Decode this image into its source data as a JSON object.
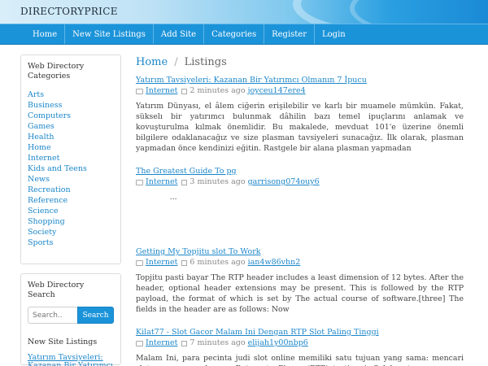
{
  "site": {
    "brand": "DIRECTORYPRICE"
  },
  "nav": [
    "Home",
    "New Site Listings",
    "Add Site",
    "Categories",
    "Register",
    "Login"
  ],
  "sidebar": {
    "directory_title": "Web Directory Categories",
    "categories": [
      "Arts",
      "Business",
      "Computers",
      "Games",
      "Health",
      "Home",
      "Internet",
      "Kids and Teens",
      "News",
      "Recreation",
      "Reference",
      "Science",
      "Shopping",
      "Society",
      "Sports"
    ],
    "search_title": "Web Directory Search",
    "search_placeholder": "Search..",
    "search_button": "Search",
    "new_listings_title": "New Site Listings",
    "new_listings": [
      "Yatırım Tavsiyeleri: Kazanan Bir Yatırımcı Olma"
    ]
  },
  "breadcrumb": {
    "home": "Home",
    "separator": "/",
    "current": "Listings"
  },
  "posts": [
    {
      "title": "Yatırım Tavsiyeleri: Kazanan Bir Yatırımcı Olmanın 7 İpucu",
      "category": "Internet",
      "time": "2 minutes ago",
      "author": "joyceu147ere4",
      "excerpt": "Yatırım Dünyası, el âlem ciğerin erişilebilir ve karlı bir muamele mümkün. Fakat, sükselı bir yatırımcı bulunmak dâhilin bazı temel ipuçlarını anlamak ve kovuşturulma kılmak önemlidir. Bu makalede, mevduat 101'e üzerine önemli bilgilere odaklanacağız ve size plasman tavsiyeleri sunacağız. İlk olarak, plasman yapmadan önce kendinizi eğitin. Rastgele bir alana plasman yapmadan"
    },
    {
      "title": "The Greatest Guide To ￼￼￼￼pg￼￼￼",
      "category": "Internet",
      "time": "3 minutes ago",
      "author": "garrisong074ouy6",
      "excerpt": "￼￼￼￼￼￼￼￼￼￼￼￼￼￼￼￼￼￼￼￼￼￼￼￼￼ ￼￼￼￼￼￼￼￼￼￼￼￼￼￼￼￼￼￼￼￼￼￼￼ ￼￼￼￼￼￼￼￼￼￼￼￼￼￼￼￼￼￼￼￼￼￼￼￼￼￼￼￼￼ ￼￼￼￼￼￼￼￼￼ ￼￼￼￼￼￼￼￼￼￼￼￼￼￼￼￼￼￼￼￼￼￼￼￼￼￼￼￼￼￼￼￼￼￼￼￼￼￼￼￼￼￼￼￼￼￼￼￼￼ ￼￼￼￼￼￼￼￼￼￼￼￼￼￼￼￼￼￼￼￼￼ ￼￼￼￼￼￼￼￼ ￼￼￼￼￼￼￼￼￼￼￼￼￼￼￼￼￼￼￼￼￼ ￼￼￼￼￼￼￼ ￼￼￼￼￼￼￼￼ ￼￼￼￼￼ ￼￼￼￼￼￼￼￼￼￼￼￼￼ ￼￼￼￼￼￼￼￼￼￼￼￼ ￼￼￼￼￼￼￼￼￼￼￼￼￼￼￼￼￼ ￼￼￼￼￼￼￼￼￼￼￼￼￼￼￼￼￼￼￼￼￼￼￼￼￼￼￼￼￼￼￼￼￼￼￼￼￼￼￼￼￼￼￼￼￼￼￼￼￼￼￼￼￼￼￼￼..."
    },
    {
      "title": "Getting My Topjitu slot To Work",
      "category": "Internet",
      "time": "6 minutes ago",
      "author": "ian4w86vhn2",
      "excerpt": "Topjitu pasti bayar The RTP header includes a least dimension of 12 bytes. After the header, optional header extensions may be present. This is followed by the RTP payload, the format of which is set by The actual course of software.[three] The fields in the header are as follows: Now"
    },
    {
      "title": "Kilat77 - Slot Gacor Malam Ini Dengan RTP Slot Paling Tinggi",
      "category": "Internet",
      "time": "7 minutes ago",
      "author": "elijah1y00nbp6",
      "excerpt": "Malam Ini, para pecinta judi slot online memiliki satu tujuan yang sama: mencari slot yang gacor dengan Return to Player (RTP) tertinggi. Salah satu game yang mungkin"
    }
  ]
}
